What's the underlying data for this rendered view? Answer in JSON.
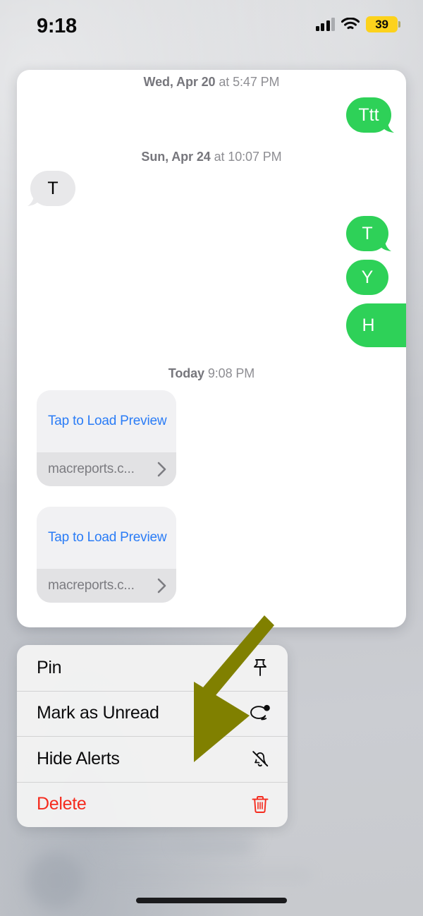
{
  "status_bar": {
    "time": "9:18",
    "battery_level": "39",
    "battery_color": "#fcd21c",
    "signal_icon": "cellular-signal-icon",
    "wifi_icon": "wifi-icon",
    "battery_icon": "battery-icon"
  },
  "conversation": {
    "timestamps": [
      {
        "day": "Wed, Apr 20",
        "time": "at 5:47 PM"
      },
      {
        "day": "Sun, Apr 24",
        "time": "at 10:07 PM"
      },
      {
        "day": "Today",
        "time": "9:08 PM"
      }
    ],
    "messages": [
      {
        "text": "Ttt",
        "side": "outgoing",
        "tail": true
      },
      {
        "text": "T",
        "side": "incoming",
        "tail": true
      },
      {
        "text": "T",
        "side": "outgoing",
        "tail": true
      },
      {
        "text": "Y",
        "side": "outgoing",
        "tail": false
      },
      {
        "text": "H",
        "side": "outgoing",
        "tail": true
      }
    ],
    "link_previews": [
      {
        "action": "Tap to Load Preview",
        "url": "macreports.c...",
        "chevron_icon": "chevron-right-icon"
      },
      {
        "action": "Tap to Load Preview",
        "url": "macreports.c...",
        "chevron_icon": "chevron-right-icon"
      }
    ],
    "bubble_colors": {
      "outgoing": "#2ed158",
      "incoming": "#e8e8ea",
      "link": "#2a7cf6"
    }
  },
  "context_menu": {
    "items": [
      {
        "label": "Pin",
        "icon": "pin-icon",
        "destructive": false
      },
      {
        "label": "Mark as Unread",
        "icon": "unread-bubble-icon",
        "destructive": false
      },
      {
        "label": "Hide Alerts",
        "icon": "bell-slash-icon",
        "destructive": false
      },
      {
        "label": "Delete",
        "icon": "trash-icon",
        "destructive": true
      }
    ],
    "destructive_color": "#f52b1e"
  },
  "annotation": {
    "arrow_icon": "pointer-arrow-annotation",
    "arrow_color": "#808000",
    "points_at": "Hide Alerts"
  },
  "home_indicator": {
    "icon": "home-indicator-bar"
  }
}
